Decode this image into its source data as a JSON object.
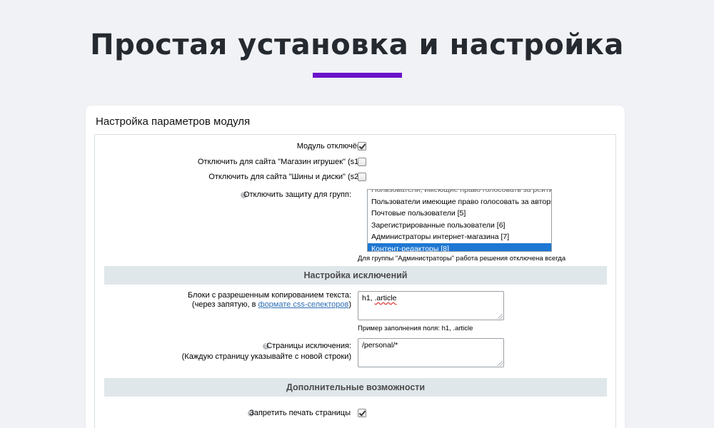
{
  "hero": {
    "title": "Простая установка и настройка",
    "accent_color": "#6b12c9"
  },
  "card": {
    "title": "Настройка параметров модуля"
  },
  "options": {
    "module_disabled": {
      "label": "Модуль отключён:",
      "checked": true
    },
    "disable_site_s1": {
      "label": "Отключить для сайта \"Магазин игрушек\" (s1):",
      "checked": false
    },
    "disable_site_s2": {
      "label": "Отключить для сайта \"Шины и диски\" (s2):",
      "checked": false
    },
    "disable_groups": {
      "label": "Отключить защиту для групп:"
    }
  },
  "groups_list": {
    "items": [
      {
        "label": "Пользователи, имеющие право голосовать за рейтинг",
        "selected": false,
        "partial": true
      },
      {
        "label": "Пользователи имеющие право голосовать за авторитет",
        "selected": false
      },
      {
        "label": "Почтовые пользователи [5]",
        "selected": false
      },
      {
        "label": "Зарегистрированные пользователи [6]",
        "selected": false
      },
      {
        "label": "Администраторы интернет-магазина [7]",
        "selected": false
      },
      {
        "label": "Контент-редакторы [8]",
        "selected": true
      }
    ],
    "note": "Для группы \"Администраторы\" работа решения отключена всегда",
    "selected_color": "#1e77d3"
  },
  "exceptions": {
    "section_title": "Настройка исключений",
    "copy_blocks": {
      "label_line1": "Блоки с разрешенным копированием текста:",
      "label_line2_prefix": "(через запятую, в ",
      "label_line2_link": "формате css-селекторов",
      "label_line2_suffix": ")",
      "value_part1": "h1, ",
      "value_part2": ".article",
      "example": "Пример заполнения поля: h1, .article"
    },
    "exclusion_pages": {
      "label_line1": "Страницы исключения:",
      "label_line2": "(Каждую страницу указывайте с новой строки)",
      "value": "/personal/*"
    }
  },
  "extra": {
    "section_title": "Дополнительные возможности",
    "disable_print": {
      "label": "Запретить печать страницы",
      "checked": true
    }
  },
  "icons": {
    "help": "help-icon",
    "checkbox": "checkbox-icon"
  }
}
